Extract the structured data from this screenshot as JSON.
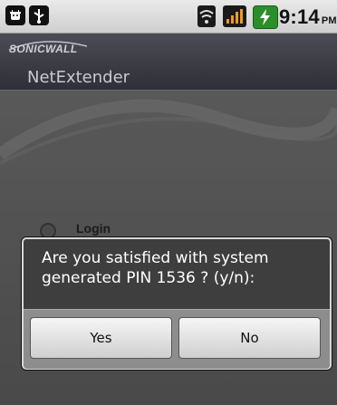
{
  "status_bar": {
    "icons": [
      "android-debug-icon",
      "usb-icon",
      "wifi-icon",
      "signal-icon",
      "battery-charging-icon"
    ],
    "time": "9:14",
    "ampm": "PM"
  },
  "header": {
    "brand": "SONICWALL",
    "app_name": "NetExtender"
  },
  "content": {
    "login_label": "Login"
  },
  "dialog": {
    "message": "Are you satisfied with system generated PIN 1536 ? (y/n):",
    "yes_label": "Yes",
    "no_label": "No"
  },
  "colors": {
    "header_bg": "#3b3b43",
    "dialog_bg": "#3e3e3e",
    "button_bar": "#8d8d8d",
    "battery_green": "#2a8f2a"
  }
}
